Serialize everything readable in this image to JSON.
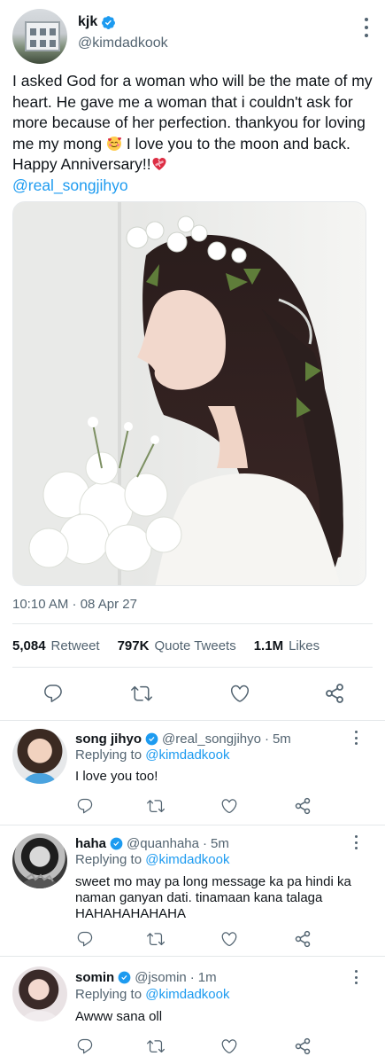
{
  "tweet": {
    "display_name": "kjk",
    "handle": "@kimdadkook",
    "text_part1": "I asked God for a woman who will be the mate of my heart. He gave me a woman that i couldn't ask for more because of her perfection. thankyou for loving me my mong ",
    "emoji1": "smiling-face-with-hearts",
    "text_part2": " I love you to the moon and back. Happy Anniversary!!",
    "emoji2": "mending-heart",
    "mention": "@real_songjihyo",
    "timestamp": "10:10 AM · 08 Apr 27",
    "stats": {
      "retweets_count": "5,084",
      "retweets_label": "Retweet",
      "quotes_count": "797K",
      "quotes_label": "Quote Tweets",
      "likes_count": "1.1M",
      "likes_label": "Likes"
    },
    "actions": [
      "reply-icon",
      "retweet-icon",
      "like-icon",
      "share-icon"
    ]
  },
  "replies": [
    {
      "display_name": "song jihyo",
      "handle": "@real_songjihyo",
      "dot": "·",
      "time": "5m",
      "verified": true,
      "replying_prefix": "Replying to",
      "replying_to": "@kimdadkook",
      "text": "I love you too!"
    },
    {
      "display_name": "haha",
      "handle": "@quanhaha",
      "dot": "·",
      "time": "5m",
      "verified": true,
      "replying_prefix": "Replying to",
      "replying_to": "@kimdadkook",
      "text": "sweet mo may pa long message ka pa hindi ka naman ganyan dati. tinamaan kana talaga HAHAHAHAHAHA"
    },
    {
      "display_name": "somin",
      "handle": "@jsomin",
      "dot": "·",
      "time": "1m",
      "verified": true,
      "replying_prefix": "Replying to",
      "replying_to": "@kimdadkook",
      "text": "Awww sana oll"
    }
  ],
  "colors": {
    "accent": "#1d9bf0",
    "text": "#0f1419",
    "secondary": "#536471",
    "divider": "#e4e8ea"
  }
}
